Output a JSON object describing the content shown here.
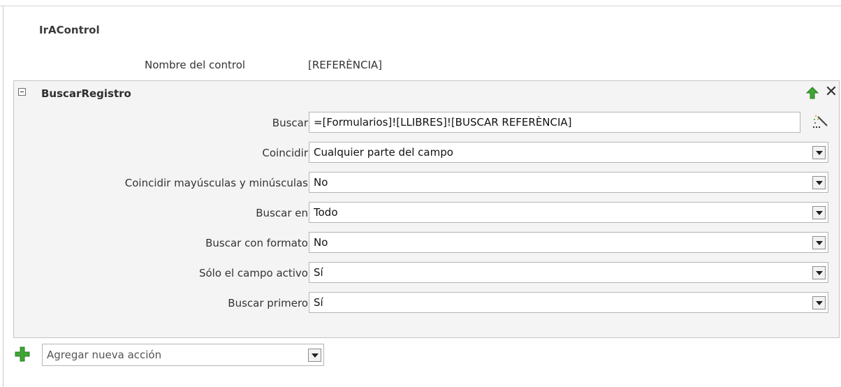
{
  "action": {
    "name": "IrAControl"
  },
  "control_name": {
    "label": "Nombre del control",
    "value": "[REFERÈNCIA]"
  },
  "group": {
    "title": "BuscarRegistro",
    "collapse_icon": "collapse-minus-icon",
    "move_up_icon": "green-up-arrow-icon",
    "delete_icon": "close-x-icon",
    "fields": [
      {
        "label": "Buscar",
        "value": "=[Formularios]![LLIBRES]![BUSCAR REFERÈNCIA]",
        "control": "text-with-builder"
      },
      {
        "label": "Coincidir",
        "value": "Cualquier parte del campo",
        "control": "dropdown"
      },
      {
        "label": "Coincidir mayúsculas y minúsculas",
        "value": "No",
        "control": "dropdown"
      },
      {
        "label": "Buscar en",
        "value": "Todo",
        "control": "dropdown"
      },
      {
        "label": "Buscar con formato",
        "value": "No",
        "control": "dropdown"
      },
      {
        "label": "Sólo el campo activo",
        "value": "Sí",
        "control": "dropdown"
      },
      {
        "label": "Buscar primero",
        "value": "Sí",
        "control": "dropdown"
      }
    ]
  },
  "add_action": {
    "placeholder": "Agregar nueva acción",
    "icon": "green-plus-icon"
  },
  "colors": {
    "group_background": "#f4f4f4",
    "accent_green": "#3fa535",
    "border": "#b5b5b5"
  }
}
